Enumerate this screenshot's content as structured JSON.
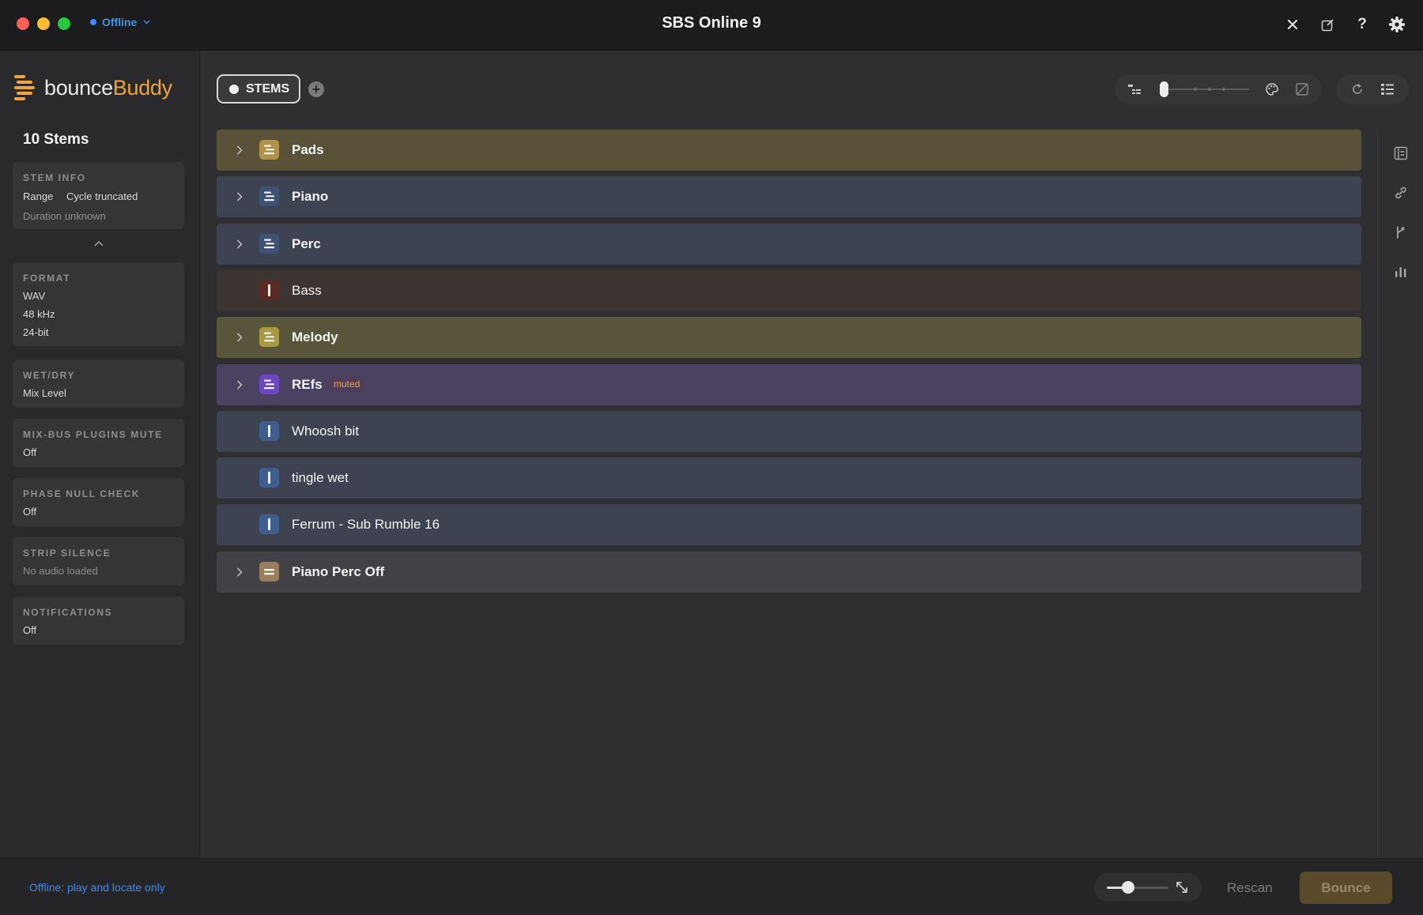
{
  "titlebar": {
    "title": "SBS Online 9",
    "status_label": "Offline",
    "icons": [
      "close-icon",
      "compose-icon",
      "help-icon",
      "gear-icon"
    ]
  },
  "sidebar": {
    "logo": {
      "part1": "bounce",
      "part2": "Buddy"
    },
    "stems_count": "10 Stems",
    "stem_info": {
      "heading": "STEM INFO",
      "range_label": "Range",
      "range_value": "Cycle truncated",
      "duration": "Duration unknown"
    },
    "format": {
      "heading": "FORMAT",
      "type": "WAV",
      "rate": "48 kHz",
      "depth": "24-bit"
    },
    "wet_dry": {
      "heading": "WET/DRY",
      "value": "Mix Level"
    },
    "mix_bus": {
      "heading": "MIX-BUS PLUGINS MUTE",
      "value": "Off"
    },
    "phase_null": {
      "heading": "PHASE NULL CHECK",
      "value": "Off"
    },
    "strip_silence": {
      "heading": "STRIP SILENCE",
      "value": "No audio loaded"
    },
    "notifications": {
      "heading": "NOTIFICATIONS",
      "value": "Off"
    }
  },
  "main": {
    "tab_label": "STEMS",
    "stems": [
      {
        "name": "Pads",
        "bg": "#5a5139",
        "icon_bg": "#b09348",
        "type": "group",
        "expandable": true
      },
      {
        "name": "Piano",
        "bg": "#3d4350",
        "icon_bg": "#3f5276",
        "type": "group",
        "expandable": true
      },
      {
        "name": "Perc",
        "bg": "#3d4350",
        "icon_bg": "#3f5276",
        "type": "group",
        "expandable": true
      },
      {
        "name": "Bass",
        "bg": "#3b3431",
        "icon_bg": "#5a2b24",
        "type": "track",
        "expandable": false
      },
      {
        "name": "Melody",
        "bg": "#58553a",
        "icon_bg": "#a89a42",
        "type": "group",
        "expandable": true
      },
      {
        "name": "REfs",
        "bg": "#4a4260",
        "icon_bg": "#6b48c2",
        "type": "group",
        "expandable": true,
        "badge": "muted"
      },
      {
        "name": "Whoosh bit",
        "bg": "#3d4350",
        "icon_bg": "#3f5d8e",
        "type": "track",
        "expandable": false
      },
      {
        "name": "tingle wet",
        "bg": "#3d4350",
        "icon_bg": "#3f5d8e",
        "type": "track",
        "expandable": false
      },
      {
        "name": "Ferrum - Sub Rumble 16",
        "bg": "#3d4350",
        "icon_bg": "#3f5d8e",
        "type": "track",
        "expandable": false
      },
      {
        "name": "Piano Perc Off",
        "bg": "#424246",
        "icon_bg": "#9a7e5c",
        "type": "group2",
        "expandable": true
      }
    ]
  },
  "footer": {
    "status_text": "Offline: play and locate only",
    "rescan_label": "Rescan",
    "bounce_label": "Bounce",
    "zoom_level": 0.35
  }
}
